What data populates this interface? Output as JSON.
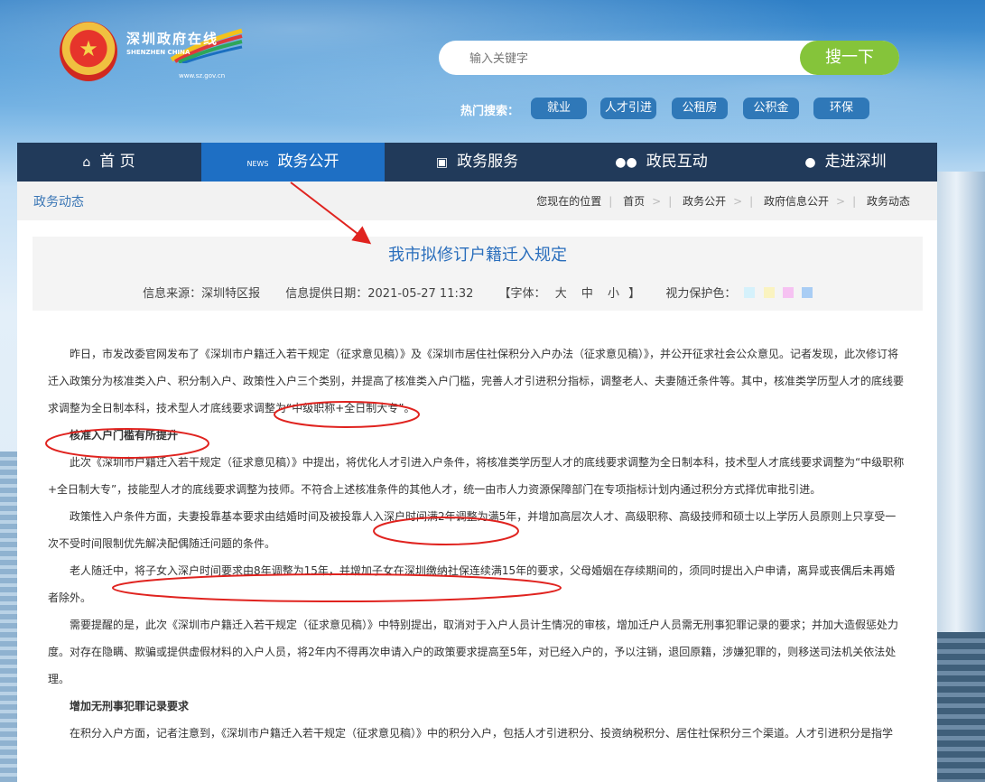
{
  "header": {
    "logo_cn": "深圳政府在线",
    "logo_en": "SHENZHEN CHINA",
    "logo_url": "www.sz.gov.cn",
    "search": {
      "placeholder": "输入关键字",
      "button": "搜一下"
    },
    "hot": {
      "label": "热门搜索：",
      "tags": [
        "就业",
        "人才引进",
        "公租房",
        "公积金",
        "环保"
      ]
    }
  },
  "nav": [
    {
      "label": "首 页",
      "icon": "home-icon"
    },
    {
      "label": "政务公开",
      "icon": "news-icon"
    },
    {
      "label": "政务服务",
      "icon": "monitor-icon"
    },
    {
      "label": "政民互动",
      "icon": "users-icon"
    },
    {
      "label": "走进深圳",
      "icon": "chat-icon"
    }
  ],
  "breadcrumb": {
    "section": "政务动态",
    "prefix": "您现在的位置",
    "items": [
      "首页",
      "政务公开",
      "政府信息公开",
      "政务动态"
    ]
  },
  "article": {
    "title": "我市拟修订户籍迁入规定",
    "source": "信息来源：深圳特区报",
    "date": "信息提供日期：2021-05-27 11:32",
    "font_label": "【字体：",
    "font_sizes": [
      "大",
      "中",
      "小"
    ],
    "font_close": "】",
    "eye_label": "视力保护色：",
    "eye_colors": [
      "#d5f1fb",
      "#faf3c0",
      "#f6c2f2",
      "#a9cdf4"
    ],
    "p1": "昨日，市发改委官网发布了《深圳市户籍迁入若干规定（征求意见稿）》及《深圳市居住社保积分入户办法（征求意见稿）》，并公开征求社会公众意见。记者发现，此次修订将迁入政策分为核准类入户、积分制入户、政策性入户三个类别，并提高了核准类入户门槛，完善人才引进积分指标，调整老人、夫妻随迁条件等。其中，核准类学历型人才的底线要求调整为全日制本科，技术型人才底线要求调整为“中级职称+全日制大专”。",
    "h1": "核准入户门槛有所提升",
    "p2": "此次《深圳市户籍迁入若干规定（征求意见稿）》中提出，将优化人才引进入户条件，将核准类学历型人才的底线要求调整为全日制本科，技术型人才底线要求调整为“中级职称+全日制大专”，技能型人才的底线要求调整为技师。不符合上述核准条件的其他人才，统一由市人力资源保障部门在专项指标计划内通过积分方式择优审批引进。",
    "p3": "政策性入户条件方面，夫妻投靠基本要求由结婚时间及被投靠人入深户时间满2年调整为满5年，并增加高层次人才、高级职称、高级技师和硕士以上学历人员原则上只享受一次不受时间限制优先解决配偶随迁问题的条件。",
    "p4": "老人随迁中，将子女入深户时间要求由8年调整为15年，并增加子女在深圳缴纳社保连续满15年的要求，父母婚姻在存续期间的，须同时提出入户申请，离异或丧偶后未再婚者除外。",
    "p5": "需要提醒的是，此次《深圳市户籍迁入若干规定（征求意见稿）》中特别提出，取消对于入户人员计生情况的审核，增加迁户人员需无刑事犯罪记录的要求；并加大造假惩处力度。对存在隐瞒、欺骗或提供虚假材料的入户人员，将2年内不得再次申请入户的政策要求提高至5年，对已经入户的，予以注销，退回原籍，涉嫌犯罪的，则移送司法机关依法处理。",
    "h2": "增加无刑事犯罪记录要求",
    "p6": "在积分入户方面，记者注意到，《深圳市户籍迁入若干规定（征求意见稿）》中的积分入户，包括人才引进积分、投资纳税积分、居住社保积分三个渠道。人才引进积分是指学"
  },
  "colors": {
    "nav_bg": "#213a5a",
    "nav_active": "#1e6fc4",
    "accent": "#2a6ebc",
    "search_btn": "#85c43a",
    "annotation": "#e0231f"
  }
}
